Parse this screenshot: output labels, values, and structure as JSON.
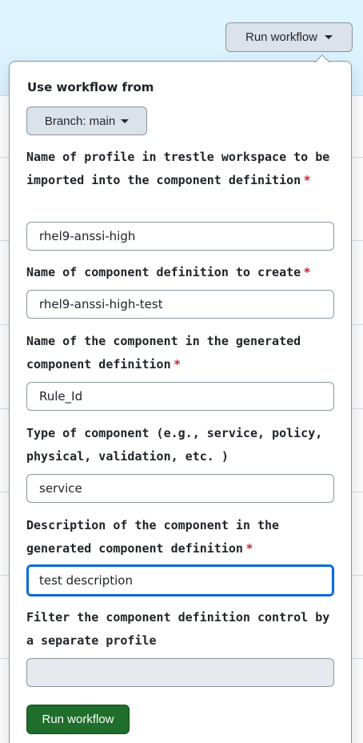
{
  "header": {
    "run_workflow_label": "Run workflow"
  },
  "popover": {
    "section_title": "Use workflow from",
    "branch_label": "Branch: main",
    "required_marker": "*",
    "fields": [
      {
        "label": "Name of profile in trestle workspace to be imported into the component definition",
        "required": true,
        "value": ""
      },
      {
        "label": "Name of component definition to create",
        "required": true,
        "value": "rhel9-anssi-high-test"
      },
      {
        "label": "Name of the component in the generated component definition",
        "required": true,
        "value": "Rule_Id"
      },
      {
        "label": "Type of component (e.g., service, policy, physical, validation, etc. )",
        "required": false,
        "value": "service"
      },
      {
        "label": "Description of the component in the generated component definition",
        "required": true,
        "value": "test description"
      },
      {
        "label": "Filter the component definition control by a separate profile",
        "required": false,
        "value": ""
      }
    ],
    "field0_value": "rhel9-anssi-high",
    "submit_label": "Run workflow"
  },
  "colors": {
    "banner": "#ddf4ff",
    "primary_button": "#1f6e2b",
    "required": "#cf222e",
    "focus": "#0969da"
  },
  "icons": {
    "dropdown": "caret-down-icon"
  }
}
